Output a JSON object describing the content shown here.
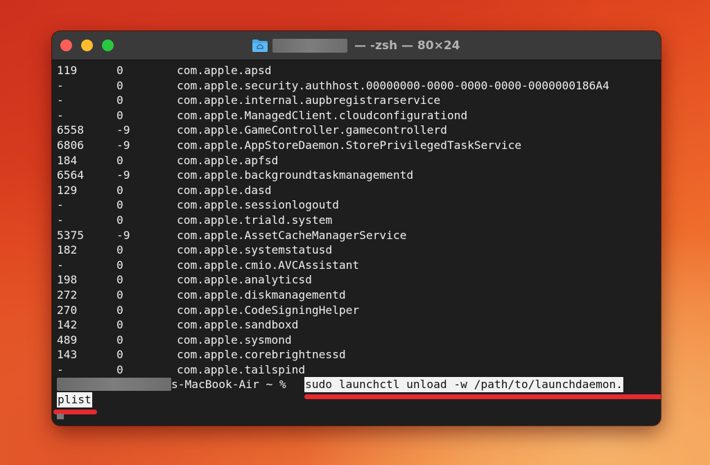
{
  "window": {
    "title_suffix": "— -zsh — 80×24",
    "title_icon": "folder-home-icon"
  },
  "rows": [
    {
      "pid": "119",
      "status": "0",
      "label": "com.apple.apsd"
    },
    {
      "pid": "-",
      "status": "0",
      "label": "com.apple.security.authhost.00000000-0000-0000-0000-0000000186A4"
    },
    {
      "pid": "-",
      "status": "0",
      "label": "com.apple.internal.aupbregistrarservice"
    },
    {
      "pid": "-",
      "status": "0",
      "label": "com.apple.ManagedClient.cloudconfigurationd"
    },
    {
      "pid": "6558",
      "status": "-9",
      "label": "com.apple.GameController.gamecontrollerd"
    },
    {
      "pid": "6806",
      "status": "-9",
      "label": "com.apple.AppStoreDaemon.StorePrivilegedTaskService"
    },
    {
      "pid": "184",
      "status": "0",
      "label": "com.apple.apfsd"
    },
    {
      "pid": "6564",
      "status": "-9",
      "label": "com.apple.backgroundtaskmanagementd"
    },
    {
      "pid": "129",
      "status": "0",
      "label": "com.apple.dasd"
    },
    {
      "pid": "-",
      "status": "0",
      "label": "com.apple.sessionlogoutd"
    },
    {
      "pid": "-",
      "status": "0",
      "label": "com.apple.triald.system"
    },
    {
      "pid": "5375",
      "status": "-9",
      "label": "com.apple.AssetCacheManagerService"
    },
    {
      "pid": "182",
      "status": "0",
      "label": "com.apple.systemstatusd"
    },
    {
      "pid": "-",
      "status": "0",
      "label": "com.apple.cmio.AVCAssistant"
    },
    {
      "pid": "198",
      "status": "0",
      "label": "com.apple.analyticsd"
    },
    {
      "pid": "272",
      "status": "0",
      "label": "com.apple.diskmanagementd"
    },
    {
      "pid": "270",
      "status": "0",
      "label": "com.apple.CodeSigningHelper"
    },
    {
      "pid": "142",
      "status": "0",
      "label": "com.apple.sandboxd"
    },
    {
      "pid": "489",
      "status": "0",
      "label": "com.apple.sysmond"
    },
    {
      "pid": "143",
      "status": "0",
      "label": "com.apple.corebrightnessd"
    },
    {
      "pid": "-",
      "status": "0",
      "label": "com.apple.tailspind"
    }
  ],
  "prompt": {
    "host": "s-MacBook-Air ~ %",
    "command_line1": "sudo launchctl unload -w /path/to/launchdaemon.",
    "command_line2": "plist"
  },
  "colors": {
    "highlight_underline": "#e62a2f",
    "terminal_bg": "#1e1e1e",
    "text": "#efefef"
  }
}
